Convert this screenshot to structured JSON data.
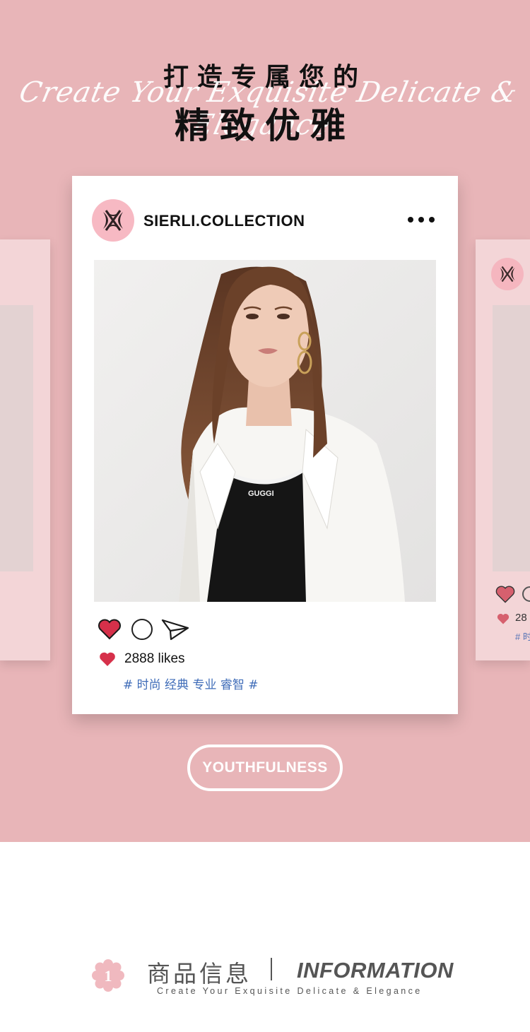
{
  "hero": {
    "title_top": "打造专属您的",
    "script_line": "Create Your Exquisite Delicate & Elegance",
    "title_main": "精致优雅",
    "background_color": "#e8b5b8"
  },
  "post": {
    "account_name": "SIERLI.COLLECTION",
    "likes_text": "2888 likes",
    "hashtags": "# 时尚 经典 专业 睿智 #",
    "shirt_print": "GUGGI",
    "icons": {
      "avatar": "brand-logo-icon",
      "more": "more-dots-icon",
      "like": "heart-icon",
      "comment": "comment-circle-icon",
      "share": "paper-plane-icon"
    },
    "heart_color": "#d6304a",
    "hashtag_color": "#3f6cb8"
  },
  "side_card": {
    "likes_partial": "28",
    "hashtag_partial": "# 时"
  },
  "pill_button": {
    "label": "YOUTHFULNESS"
  },
  "info": {
    "number": "1",
    "title_cn": "商品信息",
    "title_en": "INFORMATION",
    "subtitle": "Create Your Exquisite Delicate & Elegance"
  }
}
